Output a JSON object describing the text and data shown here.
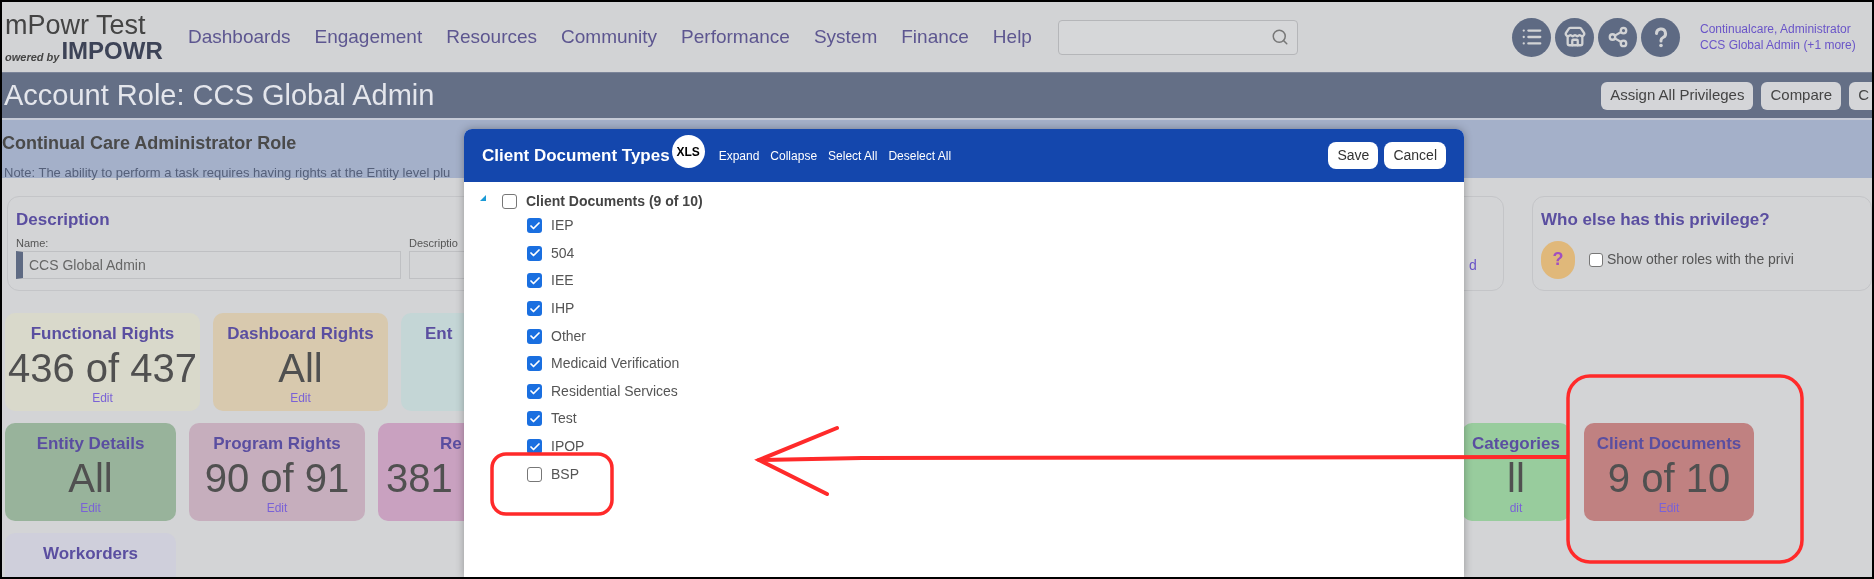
{
  "header": {
    "brand": "mPowr Test",
    "tagline": "owered by",
    "logo": "IMPOWR",
    "nav": [
      "Dashboards",
      "Engagement",
      "Resources",
      "Community",
      "Performance",
      "System",
      "Finance",
      "Help"
    ],
    "user": {
      "line1": "Continualcare, Administrator",
      "line2": "CCS Global Admin (+1 more)"
    }
  },
  "title_bar": {
    "title": "Account Role: CCS Global Admin",
    "buttons": [
      "Assign All Privileges",
      "Compare",
      "C"
    ]
  },
  "role": {
    "name": "Continual Care Administrator Role",
    "note": "Note: The ability to perform a task requires having rights at the Entity level plu"
  },
  "description": {
    "heading": "Description",
    "name_label": "Name:",
    "name_value": "CCS Global Admin",
    "description_label": "Descriptio",
    "link_fragment": "d"
  },
  "who_else": {
    "heading": "Who else has this privilege?",
    "avatar_mark": "?",
    "option": {
      "label": "Show other roles with the privi",
      "checked": false
    }
  },
  "tile_rows": [
    [
      {
        "title": "Functional Rights",
        "value": "436 of 437",
        "edit": "Edit",
        "color": "#d9d9cb"
      },
      {
        "title": "Dashboard Rights",
        "value": "All",
        "edit": "Edit",
        "color": "#d8c9ae"
      },
      {
        "title": "Ent",
        "color": "#c4d6d6"
      }
    ],
    [
      {
        "title": "Entity Details",
        "value": "All",
        "edit": "Edit",
        "color": "#98b39b"
      },
      {
        "title": "Program Rights",
        "value": "90 of 91",
        "edit": "Edit",
        "color": "#c6aebd"
      },
      {
        "title": "Re",
        "value": "381",
        "color": "#c9a1c0"
      }
    ],
    [
      {
        "title": "Workorders",
        "color": "#cfcfdb"
      }
    ]
  ],
  "right_tiles": [
    {
      "title": "Categories",
      "value": "ll",
      "edit": "dit",
      "color": "#98cc9d"
    },
    {
      "title": "Client Documents",
      "value": "9 of 10",
      "edit": "Edit",
      "color": "#c08181"
    }
  ],
  "dialog": {
    "title": "Client Document Types",
    "badge": "XLS",
    "links": [
      "Expand",
      "Collapse",
      "Select All",
      "Deselect All"
    ],
    "buttons": [
      "Save",
      "Cancel"
    ],
    "tree": [
      {
        "label": "Client Documents (9 of 10)",
        "checked": false,
        "expanded": true,
        "children": [
          {
            "label": "IEP",
            "checked": true
          },
          {
            "label": "504",
            "checked": true
          },
          {
            "label": "IEE",
            "checked": true
          },
          {
            "label": "IHP",
            "checked": true
          },
          {
            "label": "Other",
            "checked": true
          },
          {
            "label": "Medicaid Verification",
            "checked": true
          },
          {
            "label": "Residential Services",
            "checked": true
          },
          {
            "label": "Test",
            "checked": true
          },
          {
            "label": "IPOP",
            "checked": true
          },
          {
            "label": "BSP",
            "checked": false
          }
        ]
      }
    ]
  }
}
